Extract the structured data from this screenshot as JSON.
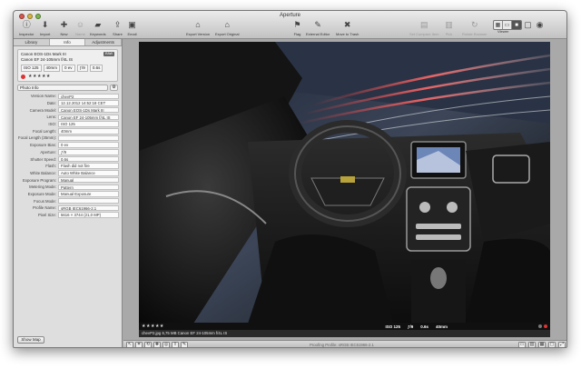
{
  "window": {
    "title": "Aperture"
  },
  "toolbar": {
    "items": [
      {
        "label": "Inspector",
        "icon": "info-icon"
      },
      {
        "label": "Import",
        "icon": "import-icon"
      },
      {
        "label": "New",
        "icon": "plus-icon"
      },
      {
        "label": "Name",
        "icon": "tag-icon"
      },
      {
        "label": "Keywords",
        "icon": "keywords-icon"
      },
      {
        "label": "Share",
        "icon": "share-icon"
      },
      {
        "label": "Email",
        "icon": "email-icon"
      },
      {
        "label": "Export Version",
        "icon": "export-version-icon"
      },
      {
        "label": "Export Original",
        "icon": "export-original-icon"
      },
      {
        "label": "Flag",
        "icon": "flag-icon"
      },
      {
        "label": "External Editor",
        "icon": "external-editor-icon"
      },
      {
        "label": "Move to Trash",
        "icon": "trash-icon"
      },
      {
        "label": "Set Compare Item",
        "icon": "compare-icon"
      },
      {
        "label": "Pick",
        "icon": "pick-icon"
      },
      {
        "label": "Rotate Browser",
        "icon": "rotate-icon"
      }
    ],
    "viewer_label": "Viewer"
  },
  "inspector": {
    "tabs": [
      "Library",
      "Info",
      "Adjustments"
    ],
    "active_tab": "Info",
    "camera_model": "Canon EOS-1Ds Mark III",
    "raw_badge": "RAW",
    "lens": "Canon EF 24-105mm f/4L IS",
    "exif": {
      "iso": "ISO 125",
      "focal": "40mm",
      "ev": "0 ev",
      "aperture": "ƒ/9",
      "shutter": "0.6s"
    },
    "rating_stars": "★★★★★",
    "preset": "Photo Info",
    "gear": "⚙",
    "fields": [
      {
        "label": "Version Name:",
        "value": "chevP2"
      },
      {
        "label": "Date:",
        "value": "12.12.2012 14:52:18 CET"
      },
      {
        "label": "Camera Model:",
        "value": "Canon EOS-1Ds Mark III"
      },
      {
        "label": "Lens:",
        "value": "Canon EF 24-105mm f/4L IS"
      },
      {
        "label": "ISO:",
        "value": "ISO 125"
      },
      {
        "label": "Focal Length:",
        "value": "40mm"
      },
      {
        "label": "Focal Length (35mm):",
        "value": ""
      },
      {
        "label": "Exposure Bias:",
        "value": "0 ev"
      },
      {
        "label": "Aperture:",
        "value": "ƒ/9"
      },
      {
        "label": "Shutter Speed:",
        "value": "0.6s"
      },
      {
        "label": "Flash:",
        "value": "Flash did not fire"
      },
      {
        "label": "White Balance:",
        "value": "Auto White Balance"
      },
      {
        "label": "Exposure Program:",
        "value": "Manual"
      },
      {
        "label": "Metering Mode:",
        "value": "Pattern"
      },
      {
        "label": "Exposure Mode:",
        "value": "Manual Exposure"
      },
      {
        "label": "Focus Mode:",
        "value": ""
      },
      {
        "label": "Profile Name:",
        "value": "sRGB IEC61966-2.1"
      },
      {
        "label": "Pixel Size:",
        "value": "5616 × 3744 (21,0 MP)"
      }
    ],
    "show_map": "Show Map"
  },
  "viewer": {
    "stars": "★★★★★",
    "exif_overlay": [
      "ISO 125",
      "ƒ/9",
      "0.6s",
      "40mm"
    ],
    "file_info": "chevP2.jpg  6,75 MB  Canon EF 24-105mm f/4L IS",
    "proofing_profile": "Proofing Profile: sRGB IEC61966-2.1"
  }
}
